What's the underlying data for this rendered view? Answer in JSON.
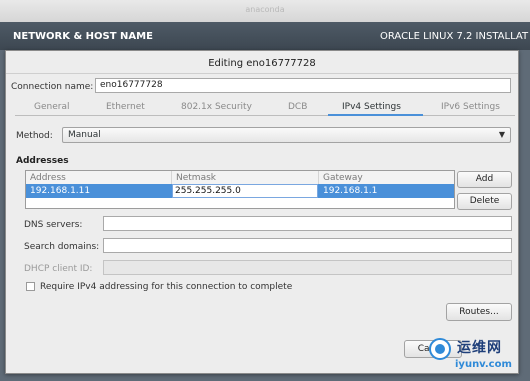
{
  "window": {
    "title": "anaconda"
  },
  "header": {
    "left": "NETWORK & HOST NAME",
    "right": "ORACLE LINUX 7.2 INSTALLAT"
  },
  "dialog": {
    "title": "Editing eno16777728",
    "connection_name_label": "Connection name:",
    "connection_name_value": "eno16777728",
    "tabs": [
      "General",
      "Ethernet",
      "802.1x Security",
      "DCB",
      "IPv4 Settings",
      "IPv6 Settings"
    ],
    "active_tab": "IPv4 Settings",
    "method_label": "Method:",
    "method_value": "Manual",
    "addresses_heading": "Addresses",
    "addresses_columns": [
      "Address",
      "Netmask",
      "Gateway"
    ],
    "addresses_rows": [
      [
        "192.168.1.11",
        "255.255.255.0",
        "192.168.1.1"
      ]
    ],
    "add_button": "Add",
    "delete_button": "Delete",
    "dns_label": "DNS servers:",
    "search_domains_label": "Search domains:",
    "dhcp_client_id_label": "DHCP client ID:",
    "require_ipv4_label": "Require IPv4 addressing for this connection to complete",
    "routes_button": "Routes...",
    "cancel_button": "Cancel",
    "accent_color": "#4a90d9"
  },
  "watermark": {
    "chinese": "运维网",
    "domain": "iyunv.com"
  }
}
